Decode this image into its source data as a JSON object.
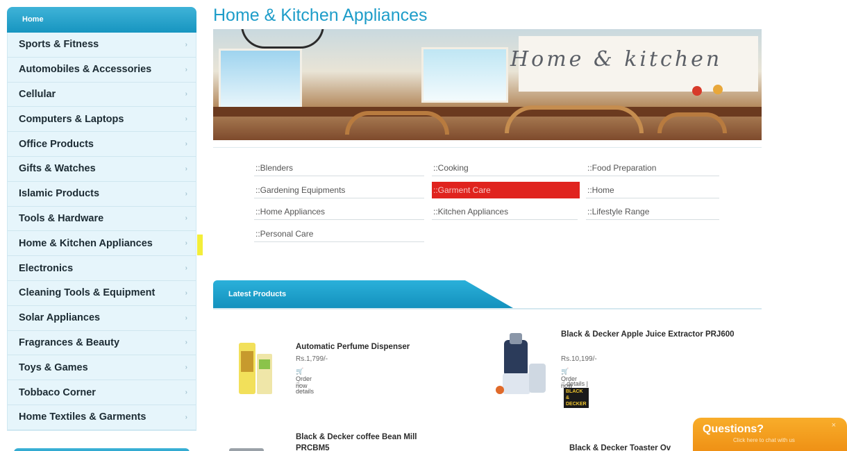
{
  "sidebar": {
    "header": "Home",
    "items": [
      {
        "label": "Sports & Fitness"
      },
      {
        "label": "Automobiles & Accessories"
      },
      {
        "label": "Cellular"
      },
      {
        "label": "Computers & Laptops"
      },
      {
        "label": "Office Products"
      },
      {
        "label": "Gifts & Watches"
      },
      {
        "label": "Islamic Products"
      },
      {
        "label": "Tools & Hardware"
      },
      {
        "label": "Home & Kitchen Appliances"
      },
      {
        "label": "Electronics"
      },
      {
        "label": "Cleaning Tools & Equipment"
      },
      {
        "label": "Solar Appliances"
      },
      {
        "label": "Fragrances & Beauty"
      },
      {
        "label": "Toys & Games"
      },
      {
        "label": "Tobbaco Corner"
      },
      {
        "label": "Home Textiles & Garments"
      }
    ],
    "chevron": "›"
  },
  "page": {
    "title": "Home & Kitchen Appliances",
    "banner_caption": "Home & kitchen"
  },
  "subcategories": [
    {
      "label": "::Blenders"
    },
    {
      "label": "::Cooking"
    },
    {
      "label": "::Food Preparation"
    },
    {
      "label": "::Gardening Equipments"
    },
    {
      "label": "::Garment Care",
      "active": true
    },
    {
      "label": "::Home"
    },
    {
      "label": "::Home Appliances"
    },
    {
      "label": "::Kitchen Appliances"
    },
    {
      "label": "::Lifestyle Range"
    },
    {
      "label": "::Personal Care"
    }
  ],
  "latest": {
    "tab_label": "Latest Products",
    "order_label": "Order now",
    "details_label": "details",
    "products": [
      {
        "name": "Automatic Perfume Dispenser",
        "price": "Rs.1,799/-"
      },
      {
        "name": "Black & Decker Apple Juice Extractor PRJ600",
        "price": "Rs.10,199/-",
        "brand": "BLACK & DECKER"
      },
      {
        "name": "Black & Decker coffee Bean Mill PRCBM5"
      },
      {
        "name": "Black & Decker Toaster Ov"
      }
    ]
  },
  "chat": {
    "title": "Questions?",
    "subtitle": "Click here to chat with us",
    "close": "×"
  },
  "colors": {
    "accent": "#1e9dc9",
    "active_subcat": "#e0231e",
    "chat": "#f39a1c"
  }
}
